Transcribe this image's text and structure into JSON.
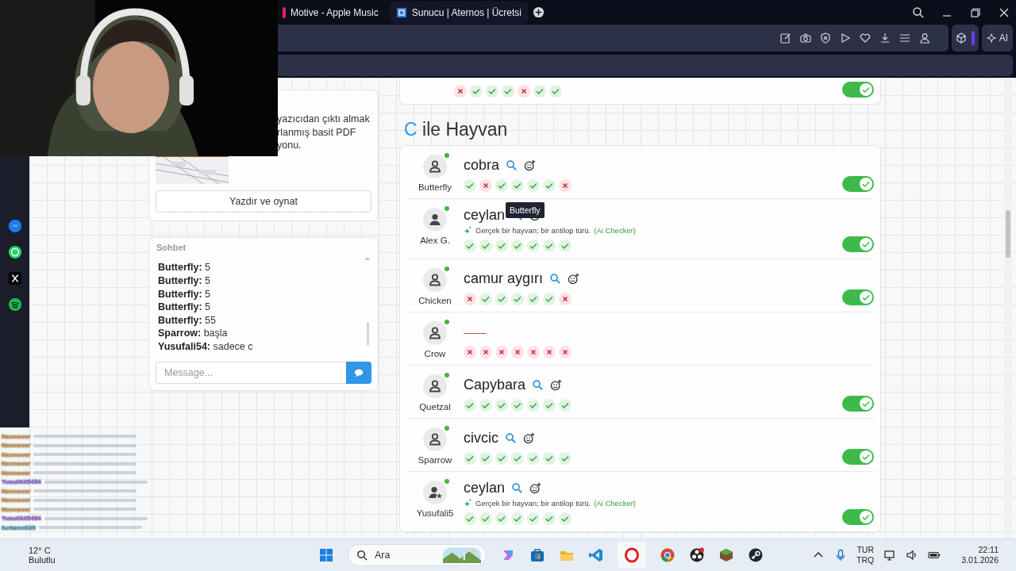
{
  "browser": {
    "tabs": [
      {
        "title": "Motive - Apple Music",
        "selected": false
      },
      {
        "title": "Sunucu | Aternos | Ücretsi",
        "selected": true
      }
    ],
    "ai_button": "AI"
  },
  "print_card": {
    "text_lines": [
      "yazıcıdan çıktı almak",
      "rlanmış basit PDF",
      "yonu."
    ],
    "button": "Yazdır ve oynat"
  },
  "chat": {
    "title": "Sohbet",
    "messages": [
      {
        "user": "Butterfly:",
        "text": "5"
      },
      {
        "user": "Butterfly:",
        "text": "5"
      },
      {
        "user": "Butterfly:",
        "text": "5"
      },
      {
        "user": "Butterfly:",
        "text": "5"
      },
      {
        "user": "Butterfly:",
        "text": "55"
      },
      {
        "user": "Sparrow:",
        "text": "başla"
      },
      {
        "user": "Yusufali54:",
        "text": "sadece c"
      }
    ],
    "placeholder": "Message..."
  },
  "top_row": {
    "marks": [
      false,
      true,
      true,
      true,
      false,
      true,
      true
    ],
    "approved": true
  },
  "section": {
    "letter": "C",
    "title": "ile Hayvan"
  },
  "rows": [
    {
      "avatar": {
        "kind": "outline"
      },
      "online": true,
      "user": "Butterfly",
      "empty": false,
      "word": "cobra",
      "marks": [
        true,
        false,
        true,
        true,
        true,
        true,
        false
      ],
      "approved": true
    },
    {
      "avatar": {
        "kind": "solid"
      },
      "online": true,
      "user": "Alex G.",
      "empty": false,
      "word": "ceylan",
      "note": {
        "text": "Gerçek bir hayvan; bir antilop türü.",
        "source": "(Ai Checker)"
      },
      "marks": [
        true,
        true,
        true,
        true,
        true,
        true,
        true
      ],
      "approved": true
    },
    {
      "avatar": {
        "kind": "outline"
      },
      "online": true,
      "user": "Chicken",
      "empty": false,
      "word": "camur aygırı",
      "marks": [
        false,
        true,
        true,
        true,
        true,
        true,
        false
      ],
      "approved": true
    },
    {
      "avatar": {
        "kind": "outline"
      },
      "online": true,
      "user": "Crow",
      "empty": true,
      "marks": [
        false,
        false,
        false,
        false,
        false,
        false,
        false
      ],
      "approved": false
    },
    {
      "avatar": {
        "kind": "outline"
      },
      "online": true,
      "user": "Quetzal",
      "empty": false,
      "word": "Capybara",
      "marks": [
        true,
        true,
        true,
        true,
        true,
        true,
        true
      ],
      "approved": true
    },
    {
      "avatar": {
        "kind": "outline"
      },
      "online": true,
      "user": "Sparrow",
      "empty": false,
      "word": "civcic",
      "marks": [
        true,
        true,
        true,
        true,
        true,
        true,
        true
      ],
      "approved": true
    },
    {
      "avatar": {
        "kind": "star"
      },
      "online": true,
      "user": "Yusufali5",
      "empty": false,
      "word": "ceylan",
      "note": {
        "text": "Gerçek bir hayvan; bir antilop türü.",
        "source": "(Ai Checker)"
      },
      "marks": [
        true,
        true,
        true,
        true,
        true,
        true,
        true
      ],
      "approved": true
    }
  ],
  "tooltip": "Butterfly",
  "stream_chat": [
    {
      "user": "Nexnover",
      "color": "#e8a33a"
    },
    {
      "user": "Nexnover",
      "color": "#e8a33a"
    },
    {
      "user": "Nexnover",
      "color": "#e8a33a"
    },
    {
      "user": "Nexnover",
      "color": "#e8a33a"
    },
    {
      "user": "Nexnover",
      "color": "#e8a33a"
    },
    {
      "user": "YusufAli5454",
      "color": "#9b6cf0"
    },
    {
      "user": "Nexnover",
      "color": "#e8a33a"
    },
    {
      "user": "Nexnover",
      "color": "#e8a33a"
    },
    {
      "user": "Nexnover",
      "color": "#e8a33a"
    },
    {
      "user": "YusufAli5454",
      "color": "#9b6cf0"
    },
    {
      "user": "furkann039",
      "color": "#3bb3c8"
    }
  ],
  "taskbar": {
    "weather": {
      "temp": "12° C",
      "text": "Bulutlu"
    },
    "search_placeholder": "Ara",
    "lang": "TUR",
    "layout": "TRQ",
    "time": "22:11",
    "date": "3.01.2026"
  }
}
